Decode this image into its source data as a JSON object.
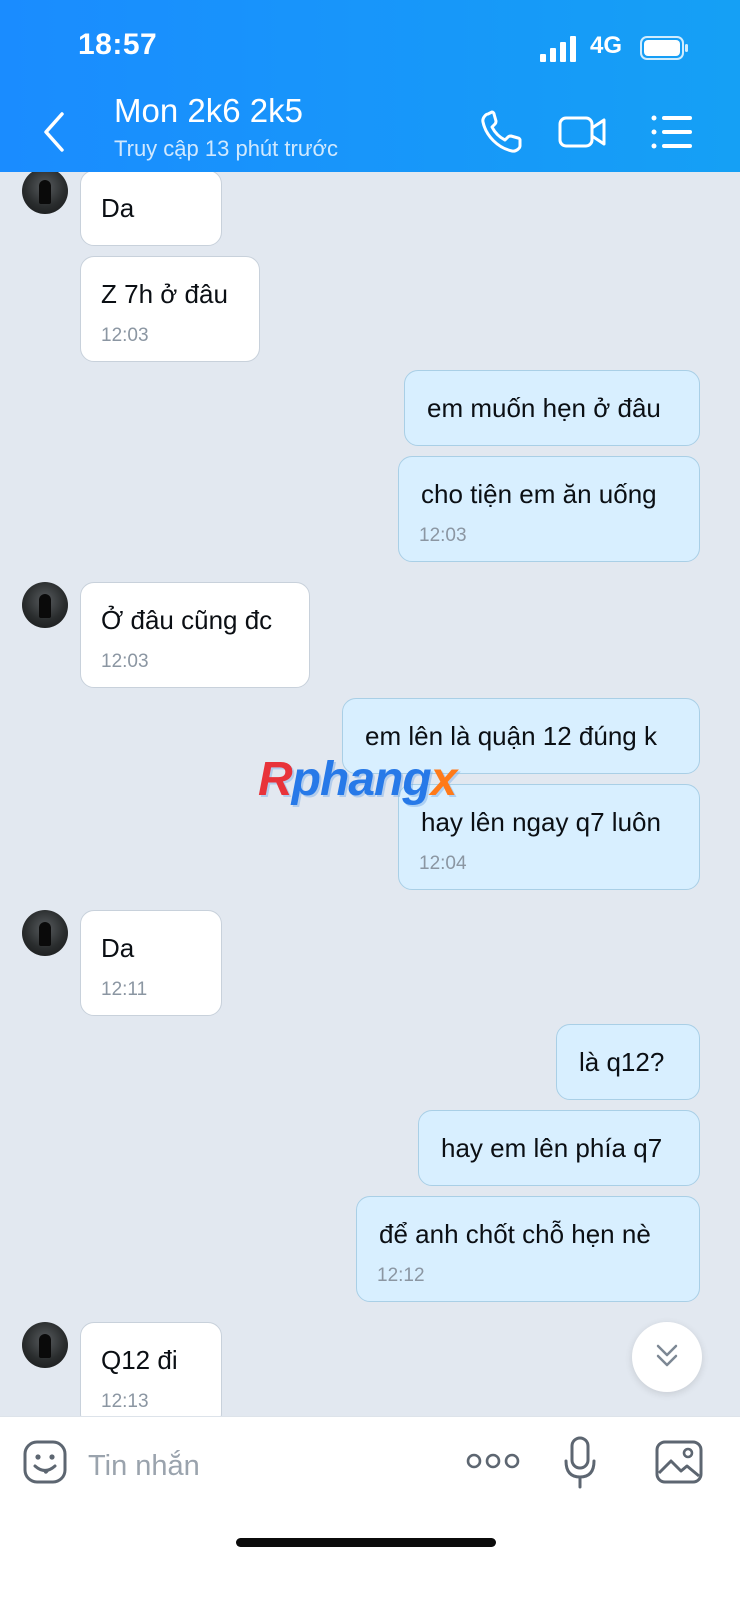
{
  "status_bar": {
    "time": "18:57",
    "network": "4G"
  },
  "header": {
    "title": "Mon 2k6 2k5",
    "subtitle": "Truy cập 13 phút trước",
    "icons": [
      "back-icon",
      "phone-icon",
      "video-call-icon",
      "menu-icon"
    ]
  },
  "messages": [
    {
      "from": "contact",
      "text": "Da",
      "time": ""
    },
    {
      "from": "contact",
      "text": "Z 7h ở đâu",
      "time": "12:03"
    },
    {
      "from": "me",
      "text": "em muốn hẹn ở đâu",
      "time": ""
    },
    {
      "from": "me",
      "text": "cho tiện em ăn uống",
      "time": "12:03"
    },
    {
      "from": "contact",
      "text": "Ở đâu cũng đc",
      "time": "12:03"
    },
    {
      "from": "me",
      "text": "em lên là quận 12 đúng k",
      "time": ""
    },
    {
      "from": "me",
      "text": "hay lên ngay q7 luôn",
      "time": "12:04"
    },
    {
      "from": "contact",
      "text": "Da",
      "time": "12:11"
    },
    {
      "from": "me",
      "text": "là q12?",
      "time": ""
    },
    {
      "from": "me",
      "text": "hay em lên phía q7",
      "time": ""
    },
    {
      "from": "me",
      "text": "để anh chốt chỗ hẹn nè",
      "time": "12:12"
    },
    {
      "from": "contact",
      "text": "Q12 đi",
      "time": "12:13"
    }
  ],
  "watermark": {
    "part1": "R",
    "part2": "phang",
    "part3": "x"
  },
  "input_bar": {
    "placeholder": "Tin nhắn",
    "icons": [
      "sticker-icon",
      "more-icon",
      "microphone-icon",
      "image-icon"
    ]
  },
  "colors": {
    "header": "#1a8cff",
    "outgoing_bubble": "#d8efff",
    "incoming_bubble": "#ffffff",
    "background": "#e2e8f0"
  }
}
